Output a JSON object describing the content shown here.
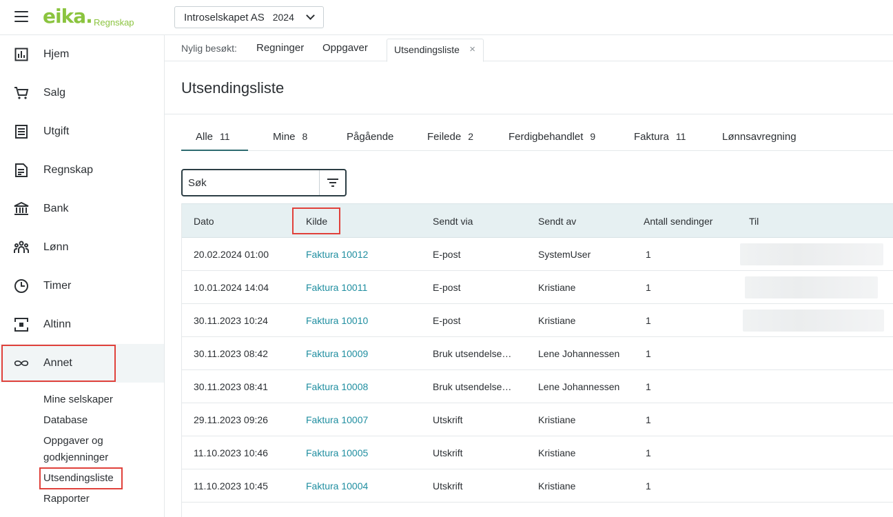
{
  "header": {
    "logo_text": "eika.",
    "logo_sub": "Regnskap",
    "company": "Introselskapet AS",
    "year": "2024"
  },
  "sidebar": {
    "items": [
      {
        "label": "Hjem",
        "icon": "chart-icon"
      },
      {
        "label": "Salg",
        "icon": "cart-icon"
      },
      {
        "label": "Utgift",
        "icon": "receipt-icon"
      },
      {
        "label": "Regnskap",
        "icon": "ledger-icon"
      },
      {
        "label": "Bank",
        "icon": "bank-icon"
      },
      {
        "label": "Lønn",
        "icon": "people-icon"
      },
      {
        "label": "Timer",
        "icon": "clock-icon"
      },
      {
        "label": "Altinn",
        "icon": "altinn-icon"
      },
      {
        "label": "Annet",
        "icon": "infinity-icon"
      }
    ],
    "sub_items": [
      {
        "label": "Mine selskaper"
      },
      {
        "label": "Database"
      },
      {
        "label": "Oppgaver og"
      },
      {
        "label": "godkjenninger"
      },
      {
        "label": "Utsendingsliste"
      },
      {
        "label": "Rapporter"
      }
    ]
  },
  "recent": {
    "label": "Nylig besøkt:",
    "tabs": [
      "Regninger",
      "Oppgaver"
    ],
    "active": "Utsendingsliste",
    "close": "×"
  },
  "page": {
    "title": "Utsendingsliste"
  },
  "filter_tabs": [
    {
      "label": "Alle",
      "count": "11"
    },
    {
      "label": "Mine",
      "count": "8"
    },
    {
      "label": "Pågående",
      "count": ""
    },
    {
      "label": "Feilede",
      "count": "2"
    },
    {
      "label": "Ferdigbehandlet",
      "count": "9"
    },
    {
      "label": "Faktura",
      "count": "11"
    },
    {
      "label": "Lønnsavregning",
      "count": ""
    }
  ],
  "search": {
    "placeholder": "Søk"
  },
  "table": {
    "columns": [
      "Dato",
      "Kilde",
      "Sendt via",
      "Sendt av",
      "Antall sendinger",
      "Til"
    ],
    "rows": [
      {
        "dato": "20.02.2024 01:00",
        "kilde": "Faktura 10012",
        "via": "E-post",
        "av": "SystemUser",
        "antall": "1"
      },
      {
        "dato": "10.01.2024 14:04",
        "kilde": "Faktura 10011",
        "via": "E-post",
        "av": "Kristiane",
        "antall": "1"
      },
      {
        "dato": "30.11.2023 10:24",
        "kilde": "Faktura 10010",
        "via": "E-post",
        "av": "Kristiane",
        "antall": "1"
      },
      {
        "dato": "30.11.2023 08:42",
        "kilde": "Faktura 10009",
        "via": "Bruk utsendelse…",
        "av": "Lene Johannessen",
        "antall": "1"
      },
      {
        "dato": "30.11.2023 08:41",
        "kilde": "Faktura 10008",
        "via": "Bruk utsendelse…",
        "av": "Lene Johannessen",
        "antall": "1"
      },
      {
        "dato": "29.11.2023 09:26",
        "kilde": "Faktura 10007",
        "via": "Utskrift",
        "av": "Kristiane",
        "antall": "1"
      },
      {
        "dato": "11.10.2023 10:46",
        "kilde": "Faktura 10005",
        "via": "Utskrift",
        "av": "Kristiane",
        "antall": "1"
      },
      {
        "dato": "11.10.2023 10:45",
        "kilde": "Faktura 10004",
        "via": "Utskrift",
        "av": "Kristiane",
        "antall": "1"
      }
    ]
  },
  "colors": {
    "brand": "#8bc43f",
    "link": "#1f8ea0",
    "highlight": "#e0403a",
    "header_bg": "#e6f0f2"
  }
}
